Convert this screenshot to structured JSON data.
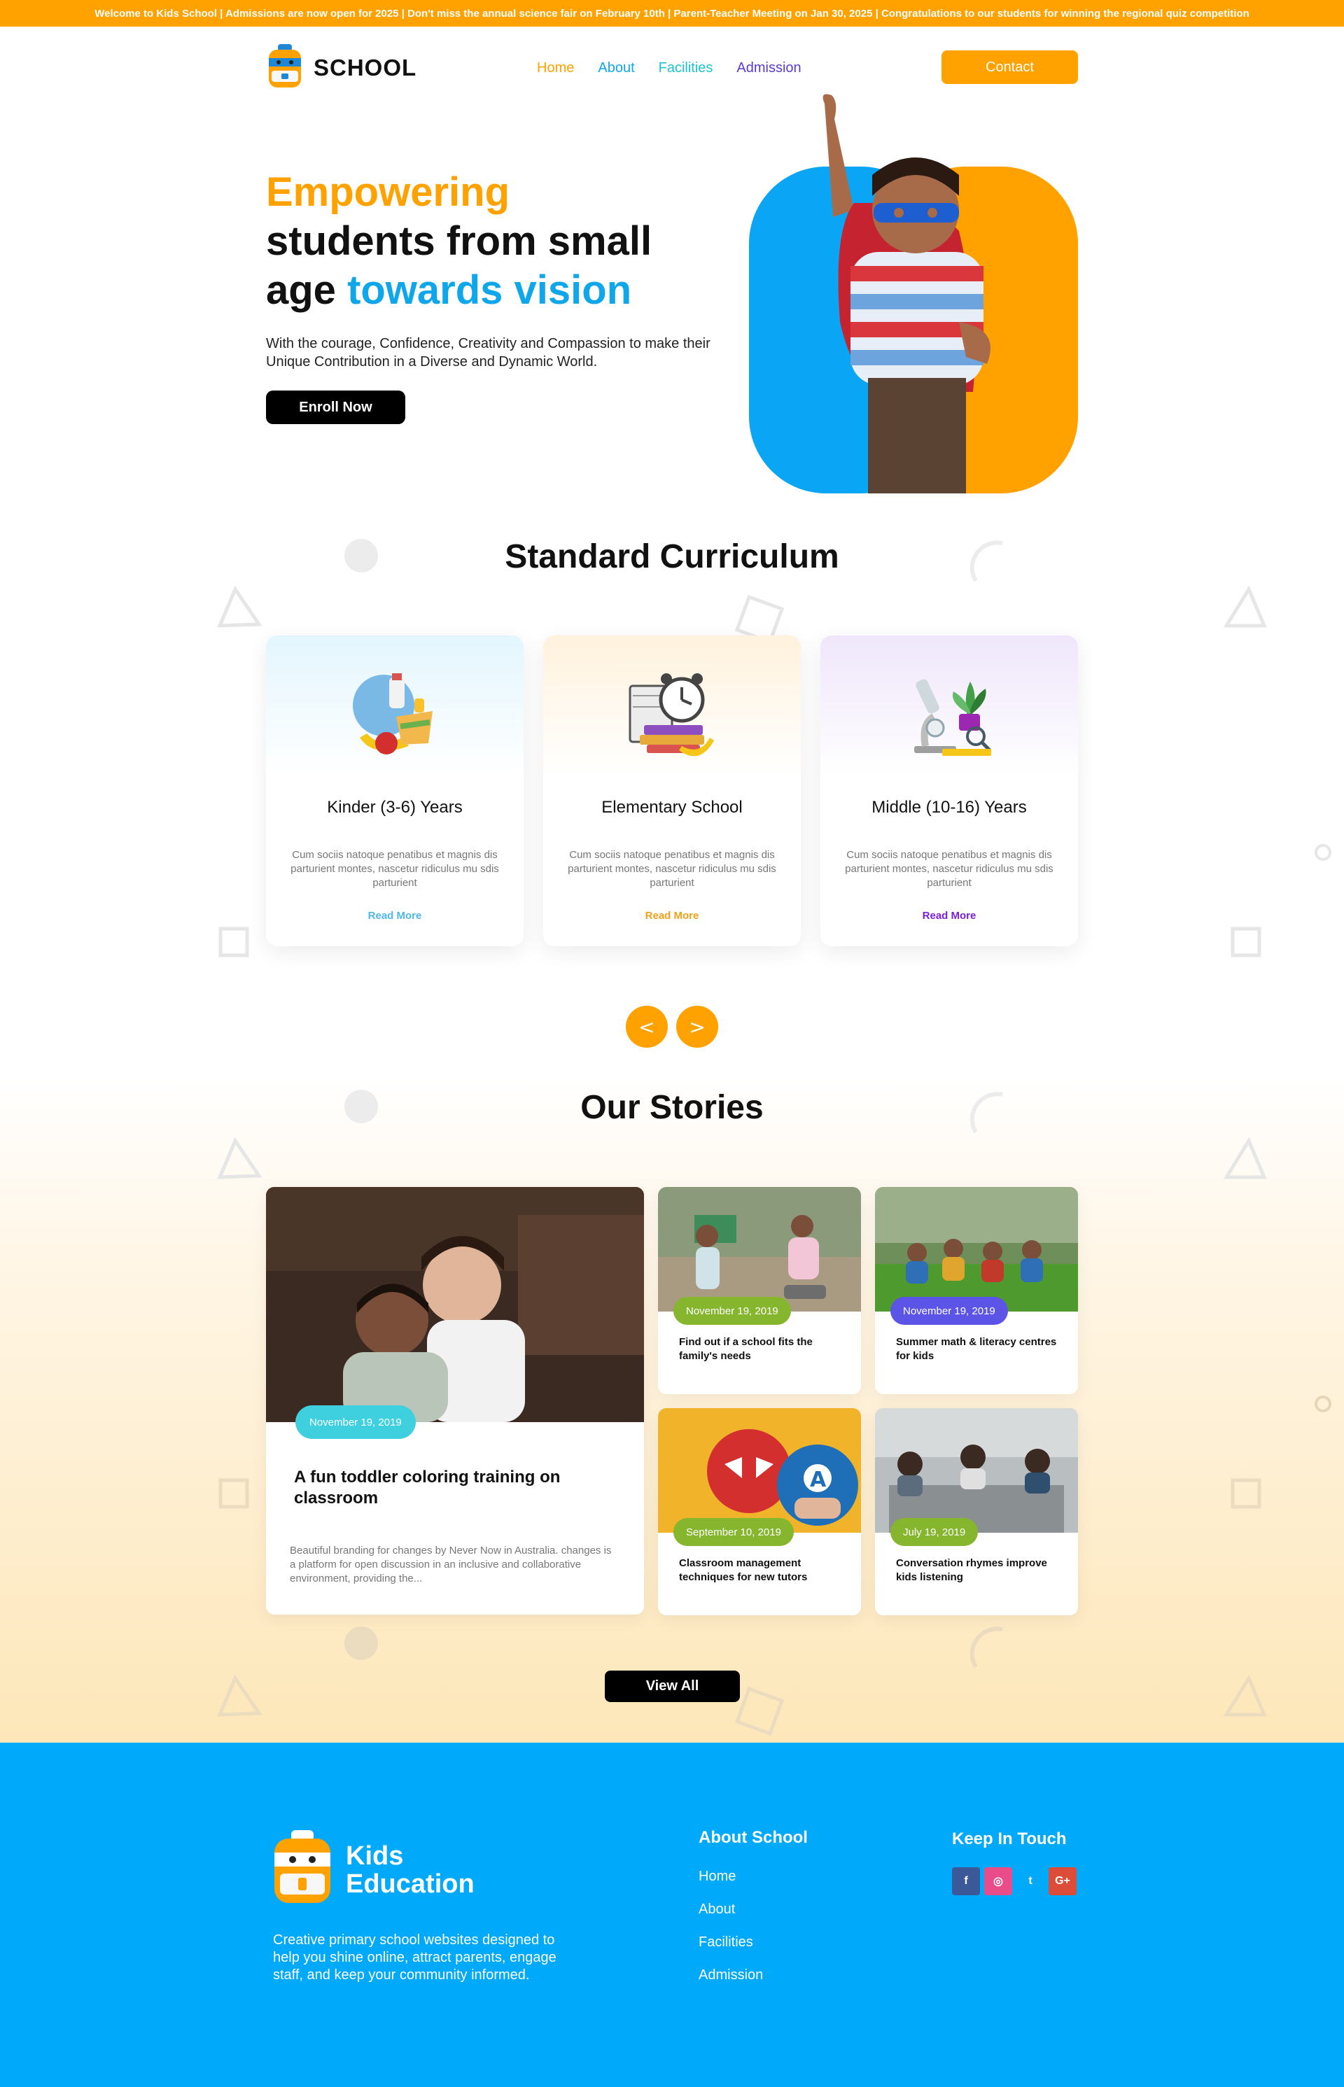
{
  "announcement": "Welcome to Kids School | Admissions are now open for 2025 | Don't miss the annual science fair on February 10th | Parent-Teacher Meeting on Jan 30, 2025 | Congratulations to our students for winning the regional quiz competition",
  "nav": {
    "brand": "SCHOOL",
    "links": [
      {
        "label": "Home",
        "color": "#ffa200"
      },
      {
        "label": "About",
        "color": "#10a7ea"
      },
      {
        "label": "Facilities",
        "color": "#1ec3d3"
      },
      {
        "label": "Admission",
        "color": "#5a3ad6"
      }
    ],
    "contact": "Contact"
  },
  "hero": {
    "title_line1": "Empowering",
    "title_line2": "students from small",
    "title_line3a": "age ",
    "title_line3b": "towards vision",
    "subtitle": "With the courage, Confidence, Creativity and Compassion to make their Unique Contribution in a Diverse and Dynamic World.",
    "cta": "Enroll Now"
  },
  "curriculum": {
    "title": "Standard Curriculum",
    "cards": [
      {
        "title": "Kinder (3-6) Years",
        "text": "Cum sociis natoque penatibus et magnis dis parturient montes, nascetur ridiculus mu sdis parturient",
        "link": "Read More",
        "link_color": "#4fb7e8",
        "icon": "lunch-food-icon"
      },
      {
        "title": "Elementary School",
        "text": "Cum sociis natoque penatibus et magnis dis parturient montes, nascetur ridiculus mu sdis parturient",
        "link": "Read More",
        "link_color": "#f0a117",
        "icon": "clock-books-icon"
      },
      {
        "title": "Middle (10-16) Years",
        "text": "Cum sociis natoque penatibus et magnis dis parturient montes, nascetur ridiculus mu sdis parturient",
        "link": "Read More",
        "link_color": "#7b1fd6",
        "icon": "microscope-plant-icon"
      }
    ],
    "prev": "<",
    "next": ">"
  },
  "stories": {
    "title": "Our Stories",
    "featured": {
      "date": "November 19, 2019",
      "date_color": "#3fd0e0",
      "title": "A fun toddler coloring training on classroom",
      "text": "Beautiful branding for changes by Never Now in Australia. changes is a platform for open discussion in an inclusive and collaborative environment, providing the..."
    },
    "items": [
      {
        "date": "November 19, 2019",
        "date_color": "#86b52e",
        "title": "Find out if a school fits the family's needs"
      },
      {
        "date": "November 19, 2019",
        "date_color": "#5b54e6",
        "title": "Summer math & literacy centres for kids"
      },
      {
        "date": "September 10, 2019",
        "date_color": "#86b52e",
        "title": "Classroom management techniques for new tutors"
      },
      {
        "date": "July 19, 2019",
        "date_color": "#86b52e",
        "title": "Conversation rhymes improve kids listening"
      }
    ],
    "view_all": "View All"
  },
  "footer": {
    "brand_line1": "Kids",
    "brand_line2": "Education",
    "description": "Creative primary school websites designed to help you shine online, attract parents, engage staff, and keep your community informed.",
    "about_title": "About School",
    "about_links": [
      "Home",
      "About",
      "Facilities",
      "Admission"
    ],
    "touch_title": "Keep In Touch",
    "socials": [
      {
        "icon": "facebook-icon",
        "glyph": "f",
        "color": "#3b5998"
      },
      {
        "icon": "dribbble-icon",
        "glyph": "◎",
        "color": "#ea4c89"
      },
      {
        "icon": "twitter-icon",
        "glyph": "t",
        "color": "#00a9fa"
      },
      {
        "icon": "google-plus-icon",
        "glyph": "G+",
        "color": "#dd4b39"
      }
    ]
  }
}
